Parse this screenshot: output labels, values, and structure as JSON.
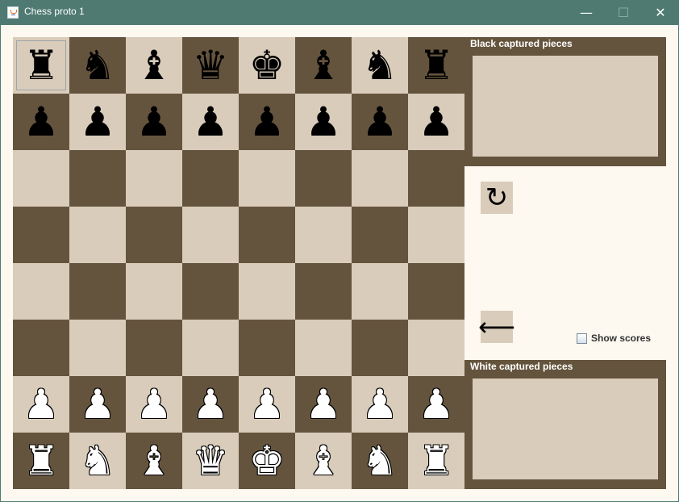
{
  "window": {
    "title": "Chess proto 1",
    "minimize_glyph": "—",
    "maximize_glyph": "☐",
    "close_glyph": "✕"
  },
  "board": {
    "selected_square": "a8",
    "colors": {
      "light": "#d9ccba",
      "dark": "#65543d"
    },
    "rows": [
      [
        {
          "glyph": "♜",
          "name": "black-rook",
          "side": "black"
        },
        {
          "glyph": "♞",
          "name": "black-knight",
          "side": "black"
        },
        {
          "glyph": "♝",
          "name": "black-bishop",
          "side": "black"
        },
        {
          "glyph": "♛",
          "name": "black-queen",
          "side": "black"
        },
        {
          "glyph": "♚",
          "name": "black-king",
          "side": "black"
        },
        {
          "glyph": "♝",
          "name": "black-bishop",
          "side": "black"
        },
        {
          "glyph": "♞",
          "name": "black-knight",
          "side": "black"
        },
        {
          "glyph": "♜",
          "name": "black-rook",
          "side": "black"
        }
      ],
      [
        {
          "glyph": "♟",
          "name": "black-pawn",
          "side": "black"
        },
        {
          "glyph": "♟",
          "name": "black-pawn",
          "side": "black"
        },
        {
          "glyph": "♟",
          "name": "black-pawn",
          "side": "black"
        },
        {
          "glyph": "♟",
          "name": "black-pawn",
          "side": "black"
        },
        {
          "glyph": "♟",
          "name": "black-pawn",
          "side": "black"
        },
        {
          "glyph": "♟",
          "name": "black-pawn",
          "side": "black"
        },
        {
          "glyph": "♟",
          "name": "black-pawn",
          "side": "black"
        },
        {
          "glyph": "♟",
          "name": "black-pawn",
          "side": "black"
        }
      ],
      [
        null,
        null,
        null,
        null,
        null,
        null,
        null,
        null
      ],
      [
        null,
        null,
        null,
        null,
        null,
        null,
        null,
        null
      ],
      [
        null,
        null,
        null,
        null,
        null,
        null,
        null,
        null
      ],
      [
        null,
        null,
        null,
        null,
        null,
        null,
        null,
        null
      ],
      [
        {
          "glyph": "♟",
          "name": "white-pawn",
          "side": "white"
        },
        {
          "glyph": "♟",
          "name": "white-pawn",
          "side": "white"
        },
        {
          "glyph": "♟",
          "name": "white-pawn",
          "side": "white"
        },
        {
          "glyph": "♟",
          "name": "white-pawn",
          "side": "white"
        },
        {
          "glyph": "♟",
          "name": "white-pawn",
          "side": "white"
        },
        {
          "glyph": "♟",
          "name": "white-pawn",
          "side": "white"
        },
        {
          "glyph": "♟",
          "name": "white-pawn",
          "side": "white"
        },
        {
          "glyph": "♟",
          "name": "white-pawn",
          "side": "white"
        }
      ],
      [
        {
          "glyph": "♜",
          "name": "white-rook",
          "side": "white"
        },
        {
          "glyph": "♞",
          "name": "white-knight",
          "side": "white"
        },
        {
          "glyph": "♝",
          "name": "white-bishop",
          "side": "white"
        },
        {
          "glyph": "♛",
          "name": "white-queen",
          "side": "white"
        },
        {
          "glyph": "♚",
          "name": "white-king",
          "side": "white"
        },
        {
          "glyph": "♝",
          "name": "white-bishop",
          "side": "white"
        },
        {
          "glyph": "♞",
          "name": "white-knight",
          "side": "white"
        },
        {
          "glyph": "♜",
          "name": "white-rook",
          "side": "white"
        }
      ]
    ]
  },
  "panels": {
    "black_captured_title": "Black captured pieces",
    "white_captured_title": "White captured pieces"
  },
  "controls": {
    "undo_icon": "↻",
    "back_icon": "⟵",
    "show_scores_label": "Show scores",
    "show_scores_checked": false
  }
}
